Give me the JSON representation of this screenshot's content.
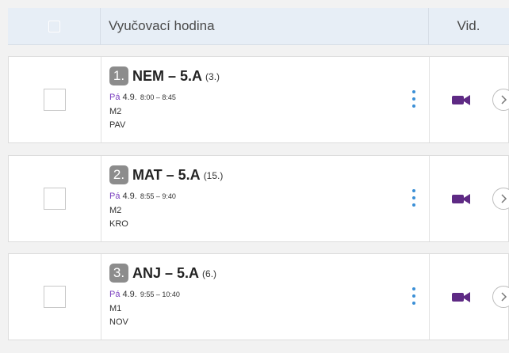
{
  "header": {
    "title_col": "Vyučovací hodina",
    "video_col": "Vid."
  },
  "lessons": [
    {
      "num": "1.",
      "subject": "NEM – 5.A",
      "count": "(3.)",
      "day": "Pá",
      "date": "4.9.",
      "time": "8:00 – 8:45",
      "room": "M2",
      "teacher": "PAV"
    },
    {
      "num": "2.",
      "subject": "MAT – 5.A",
      "count": "(15.)",
      "day": "Pá",
      "date": "4.9.",
      "time": "8:55 – 9:40",
      "room": "M2",
      "teacher": "KRO"
    },
    {
      "num": "3.",
      "subject": "ANJ – 5.A",
      "count": "(6.)",
      "day": "Pá",
      "date": "4.9.",
      "time": "9:55 – 10:40",
      "room": "M1",
      "teacher": "NOV"
    }
  ],
  "icons": {
    "video": "video-camera-icon",
    "more": "kebab-menu-icon",
    "open": "chevron-right-circle-icon"
  },
  "colors": {
    "day": "#7a3fbf",
    "camera": "#5e2a84",
    "kebab": "#3a8fd6",
    "badge": "#8c8c8c",
    "header_bg": "#e7eef6"
  }
}
